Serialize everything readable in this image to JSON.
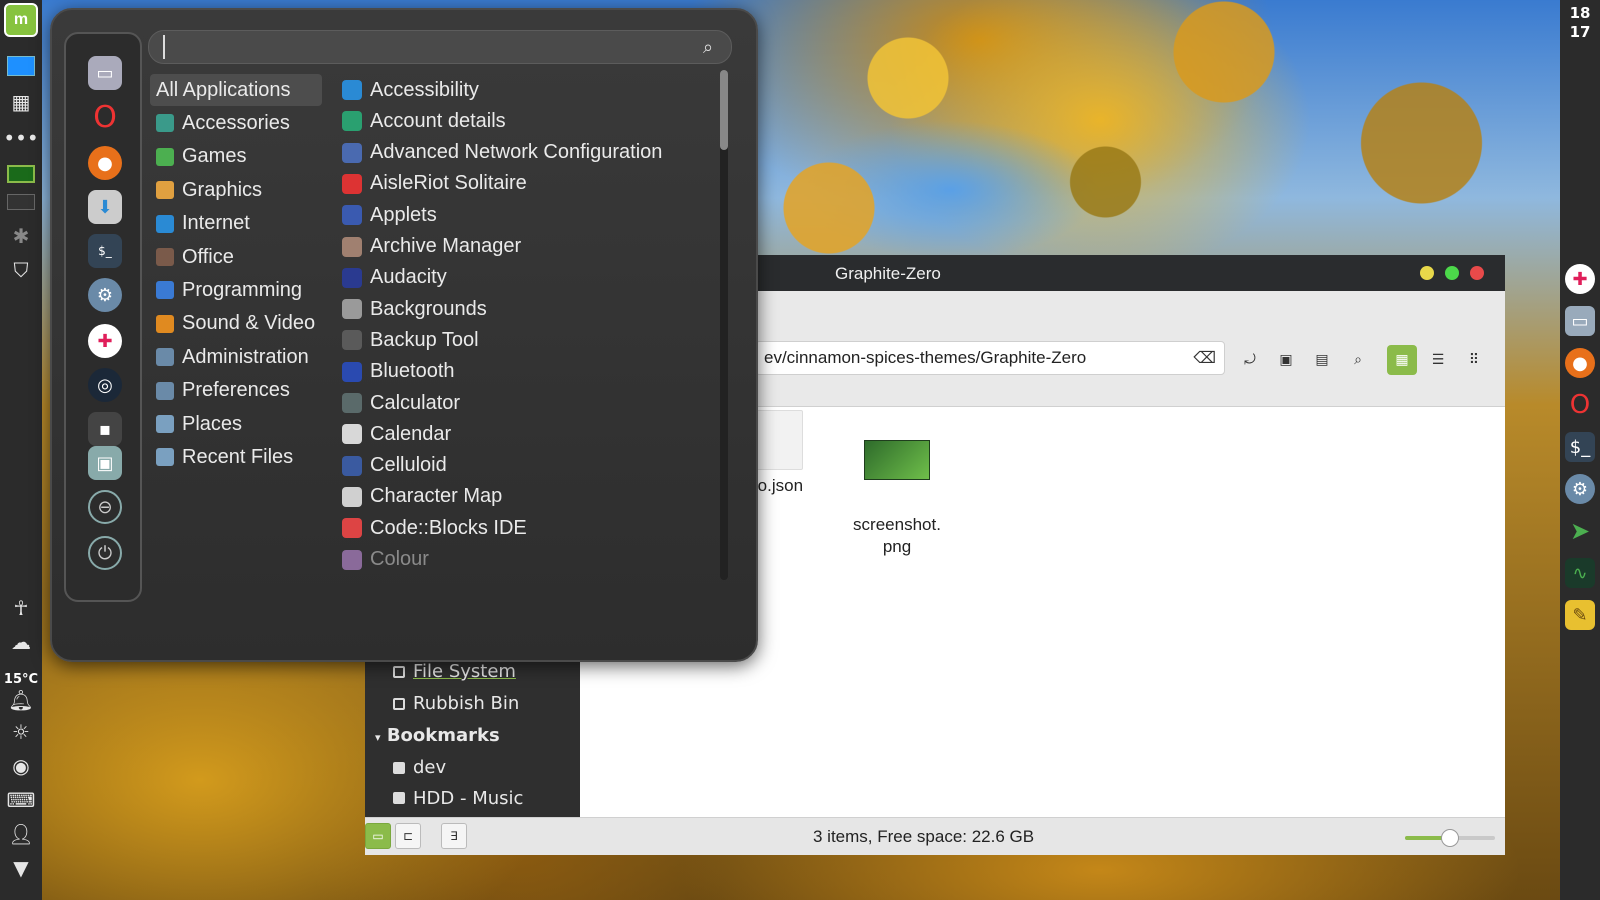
{
  "left_panel": {
    "temperature": "15°C"
  },
  "right_panel": {
    "clock_hour": "18",
    "clock_minute": "17"
  },
  "file_manager": {
    "title": "Graphite-Zero",
    "path": "ev/cinnamon-spices-themes/Graphite-Zero",
    "files": [
      {
        "name": "fo.json"
      },
      {
        "name": "screenshot.\npng"
      }
    ],
    "sidebar": {
      "file_system": "File System",
      "rubbish_bin": "Rubbish Bin",
      "bookmarks_heading": "Bookmarks",
      "dev": "dev",
      "hdd_music": "HDD - Music"
    },
    "status": "3 items, Free space: 22.6 GB",
    "zoom_level": 0.5
  },
  "menu": {
    "search": {
      "value": "",
      "placeholder": ""
    },
    "categories": [
      {
        "label": "All Applications",
        "color": "#4d4d4d"
      },
      {
        "label": "Accessories",
        "color": "#3a9a8a"
      },
      {
        "label": "Games",
        "color": "#4caf50"
      },
      {
        "label": "Graphics",
        "color": "#e0a040"
      },
      {
        "label": "Internet",
        "color": "#2a8ad4"
      },
      {
        "label": "Office",
        "color": "#7a5a4a"
      },
      {
        "label": "Programming",
        "color": "#3a7ad4"
      },
      {
        "label": "Sound & Video",
        "color": "#e08a20"
      },
      {
        "label": "Administration",
        "color": "#6a8aa8"
      },
      {
        "label": "Preferences",
        "color": "#6a8aa8"
      },
      {
        "label": "Places",
        "color": "#7aa0c0"
      },
      {
        "label": "Recent Files",
        "color": "#7aa0c0"
      }
    ],
    "apps": [
      {
        "label": "Accessibility",
        "color": "#2a8ad4"
      },
      {
        "label": "Account details",
        "color": "#2aa070"
      },
      {
        "label": "Advanced Network Configuration",
        "color": "#4a6ab0"
      },
      {
        "label": "AisleRiot Solitaire",
        "color": "#d33"
      },
      {
        "label": "Applets",
        "color": "#3a5ab0"
      },
      {
        "label": "Archive Manager",
        "color": "#a08070"
      },
      {
        "label": "Audacity",
        "color": "#2a3a90"
      },
      {
        "label": "Backgrounds",
        "color": "#9a9a9a"
      },
      {
        "label": "Backup Tool",
        "color": "#5a5a5a"
      },
      {
        "label": "Bluetooth",
        "color": "#2a4ab0"
      },
      {
        "label": "Calculator",
        "color": "#5a6a6a"
      },
      {
        "label": "Calendar",
        "color": "#d8d8d8"
      },
      {
        "label": "Celluloid",
        "color": "#3a5aa0"
      },
      {
        "label": "Character Map",
        "color": "#d0d0d0"
      },
      {
        "label": "Code::Blocks IDE",
        "color": "#d44"
      },
      {
        "label": "Colour",
        "color": "#8a6a9a"
      }
    ]
  }
}
